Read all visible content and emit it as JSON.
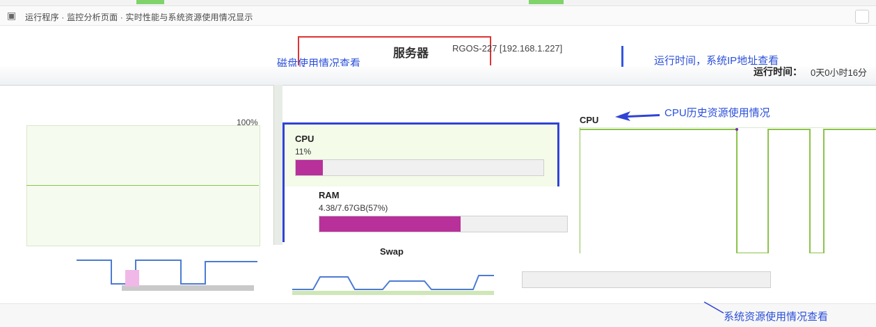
{
  "window": {
    "title": "运行程序 · 监控分析页面 · 实时性能与系统资源使用情况显示",
    "icon": "app-icon"
  },
  "header": {
    "server_label": "服务器",
    "server_info": "RGOS-227 [192.168.1.227]",
    "uptime_label": "运行时间：",
    "uptime_value": "0天0小时16分"
  },
  "annotations": {
    "disk": "磁盘使用情况查看",
    "runtime_ip": "运行时间，系统IP地址查看",
    "cpu_history": "CPU历史资源使用情况",
    "system_resources": "系统资源使用情况查看"
  },
  "left_chart": {
    "max_label": "100%"
  },
  "resources": {
    "cpu": {
      "title": "CPU",
      "value": "11%",
      "percent": 11
    },
    "ram": {
      "title": "RAM",
      "value": "4.38/7.67GB(57%)",
      "percent": 57
    },
    "swap": {
      "title": "Swap"
    }
  },
  "history": {
    "title": "CPU"
  },
  "colors": {
    "accent_blue": "#2f43d6",
    "highlight_red": "#e03333",
    "bar_magenta": "#b8309a",
    "chart_green": "#8bc34a"
  }
}
